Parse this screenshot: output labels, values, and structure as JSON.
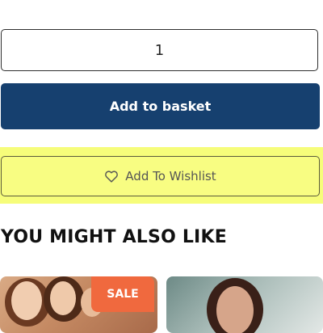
{
  "product": {
    "quantity": "1",
    "add_to_basket_label": "Add to basket",
    "wishlist_label": "Add To Wishlist"
  },
  "recommendations": {
    "title": "YOU MIGHT ALSO LIKE",
    "cards": [
      {
        "badge": "SALE"
      },
      {
        "badge": ""
      }
    ]
  },
  "colors": {
    "primary": "#16406f",
    "highlight": "#f6fd7a",
    "sale": "#f0693e"
  },
  "icons": {
    "wishlist": "heart-icon"
  }
}
